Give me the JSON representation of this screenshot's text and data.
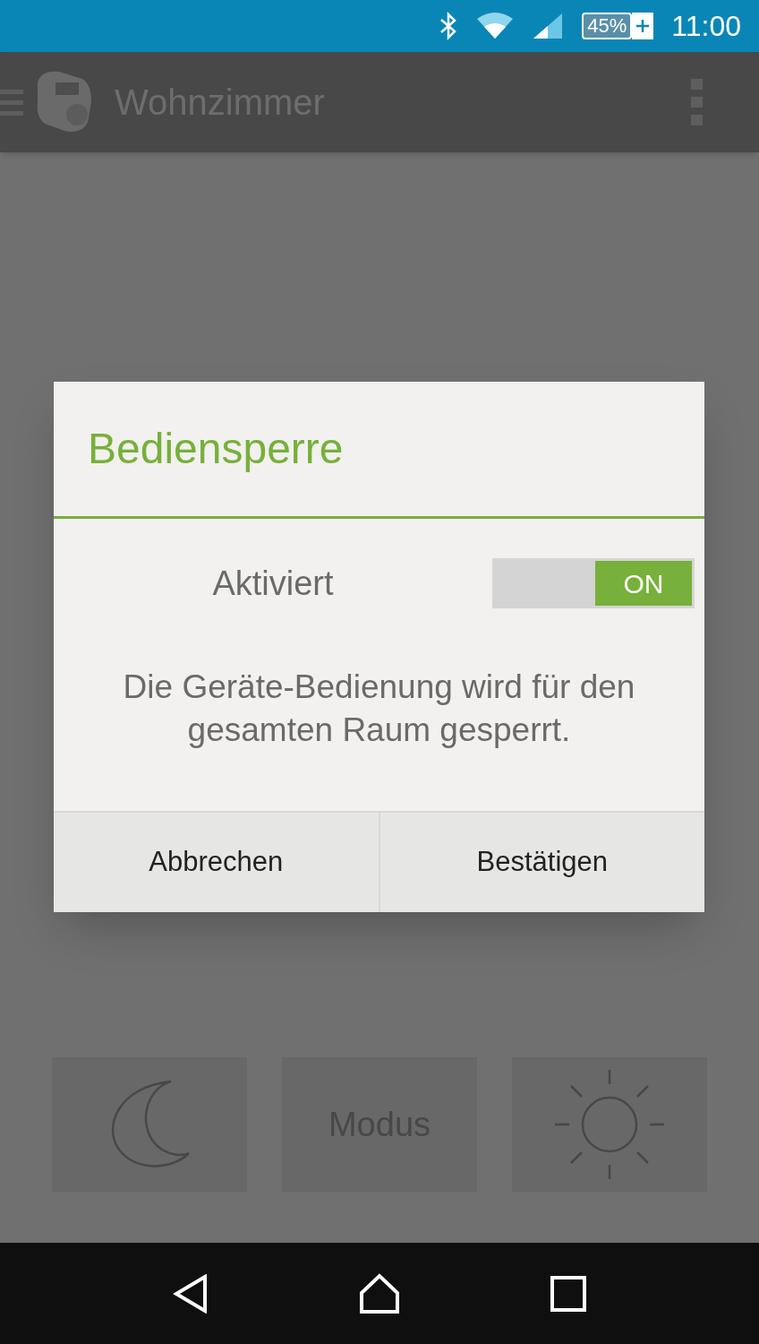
{
  "status_bar": {
    "battery": "45%",
    "time": "11:00"
  },
  "app_bar": {
    "title": "Wohnzimmer"
  },
  "dialog": {
    "title": "Bediensperre",
    "setting": {
      "label": "Aktiviert",
      "on": true,
      "state_label": "ON"
    },
    "message": "Die Geräte-Bedienung wird für den gesamten Raum gesperrt.",
    "buttons": [
      "Abbrechen",
      "Bestätigen"
    ]
  },
  "mode_buttons": [
    {
      "kind": "moon"
    },
    {
      "kind": "text",
      "label": "Modus"
    },
    {
      "kind": "sun"
    }
  ]
}
